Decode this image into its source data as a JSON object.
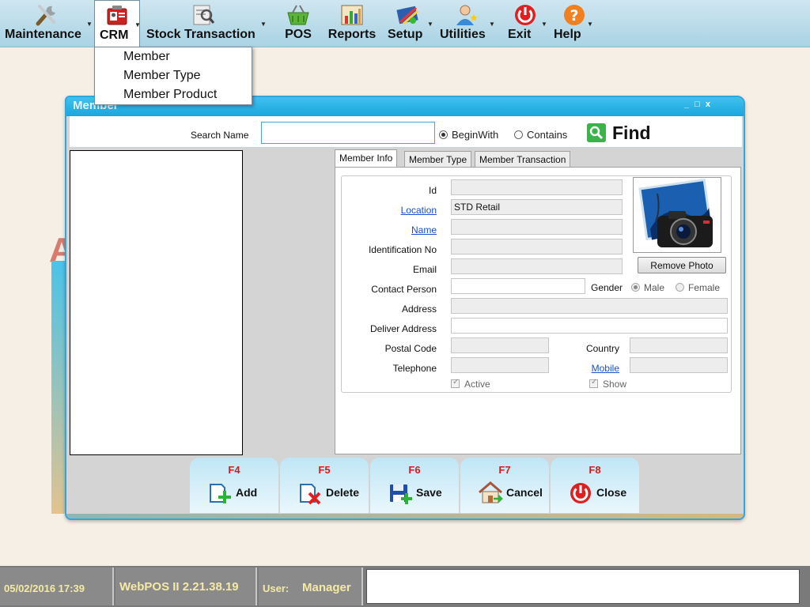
{
  "menubar": {
    "items": [
      {
        "label": "Maintenance",
        "icon": "tools-icon"
      },
      {
        "label": "CRM",
        "icon": "contact-card-icon"
      },
      {
        "label": "Stock Transaction",
        "icon": "magnifier-document-icon"
      },
      {
        "label": "POS",
        "icon": "shopping-basket-icon"
      },
      {
        "label": "Reports",
        "icon": "bar-chart-icon"
      },
      {
        "label": "Setup",
        "icon": "setup-icon"
      },
      {
        "label": "Utilities",
        "icon": "user-star-icon"
      },
      {
        "label": "Exit",
        "icon": "power-icon"
      },
      {
        "label": "Help",
        "icon": "help-icon"
      }
    ]
  },
  "crm_menu": {
    "items": [
      "Member",
      "Member Type",
      "Member Product"
    ]
  },
  "window": {
    "title": "Member",
    "controls": "_ □ x"
  },
  "search": {
    "label": "Search Name",
    "value": "",
    "radio_beginwith": "BeginWith",
    "radio_contains": "Contains",
    "selected": "BeginWith",
    "find_label": "Find"
  },
  "tabs": [
    "Member Info",
    "Member Type",
    "Member Transaction"
  ],
  "form": {
    "id_label": "Id",
    "id_value": "",
    "location_label": "Location",
    "location_value": "STD Retail",
    "name_label": "Name",
    "name_value": "",
    "idno_label": "Identification No",
    "idno_value": "",
    "email_label": "Email",
    "email_value": "",
    "contact_label": "Contact Person",
    "contact_value": "",
    "gender_label": "Gender",
    "gender_male": "Male",
    "gender_female": "Female",
    "address_label": "Address",
    "address_value": "",
    "deliver_label": "Deliver Address",
    "deliver_value": "",
    "postal_label": "Postal Code",
    "postal_value": "",
    "country_label": "Country",
    "country_value": "",
    "telephone_label": "Telephone",
    "telephone_value": "",
    "mobile_label": "Mobile",
    "mobile_value": "",
    "active_label": "Active",
    "show_label": "Show",
    "remove_photo_label": "Remove Photo"
  },
  "function_buttons": [
    {
      "key": "F4",
      "label": "Add"
    },
    {
      "key": "F5",
      "label": "Delete"
    },
    {
      "key": "F6",
      "label": "Save"
    },
    {
      "key": "F7",
      "label": "Cancel"
    },
    {
      "key": "F8",
      "label": "Close"
    }
  ],
  "status": {
    "datetime": "05/02/2016 17:39",
    "version": "WebPOS II 2.21.38.19",
    "user_label": "User:",
    "user_name": "Manager"
  },
  "background": {
    "logo_letter": "A"
  },
  "colors": {
    "menubar": "#a9d3e4",
    "window_border": "#2ea7d9",
    "function_key": "#e01818",
    "status_text": "#f4e9a5",
    "link": "#1a4fd1"
  }
}
